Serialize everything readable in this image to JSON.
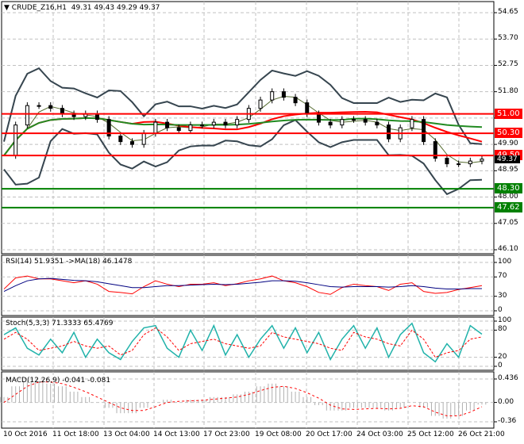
{
  "header": {
    "symbol": "CRUDE_Z16,H1",
    "ohlc": "49.31 49.43 49.29 49.37"
  },
  "indicators": {
    "rsi": "RSI(14) 51.9351  ->MA(18) 46.1478",
    "stoch": "Stoch(5,3,3) 71.3333 65.4769",
    "macd": "MACD(12,26,9) -0.041 -0.081"
  },
  "colors": {
    "resistance": "#ff0000",
    "support": "#008000",
    "bands": "#36454f",
    "ma_long": "#228b22",
    "ma_red": "#ff0000",
    "rsi": "#ff0000",
    "rsi_ma": "#000080",
    "stoch_k": "#20b2aa",
    "stoch_d": "#ff0000"
  },
  "chart_data": [
    {
      "type": "line",
      "title": "CRUDE_Z16,H1",
      "ylim": [
        46.1,
        54.65
      ],
      "yticks": [
        "54.65",
        "53.70",
        "52.75",
        "51.80",
        "50.85",
        "49.90",
        "48.95",
        "48.00",
        "47.05",
        "46.10"
      ],
      "xticks": [
        "10 Oct 2016",
        "11 Oct 18:00",
        "13 Oct 04:00",
        "14 Oct 13:00",
        "17 Oct 23:00",
        "19 Oct 08:00",
        "20 Oct 17:00",
        "24 Oct 03:00",
        "25 Oct 12:00",
        "26 Oct 21:00"
      ],
      "current_price": "49.37",
      "levels": [
        {
          "value": 51.0,
          "label": "51.00",
          "kind": "resistance"
        },
        {
          "value": 50.3,
          "label": "50.30",
          "kind": "resistance"
        },
        {
          "value": 49.5,
          "label": "49.50",
          "kind": "resistance"
        },
        {
          "value": 48.3,
          "label": "48.30",
          "kind": "support"
        },
        {
          "value": 47.62,
          "label": "47.62",
          "kind": "support"
        }
      ],
      "close": [
        49.5,
        50.6,
        51.3,
        51.3,
        51.2,
        51.0,
        50.9,
        51.0,
        50.8,
        50.2,
        50.0,
        49.9,
        50.3,
        50.7,
        50.5,
        50.4,
        50.6,
        50.6,
        50.7,
        50.6,
        50.8,
        51.2,
        51.5,
        51.8,
        51.6,
        51.4,
        51.0,
        50.7,
        50.6,
        50.8,
        50.8,
        50.7,
        50.6,
        50.1,
        50.5,
        50.8,
        50.0,
        49.4,
        49.2,
        49.2,
        49.3,
        49.37
      ]
    },
    {
      "type": "line",
      "name": "RSI",
      "ylim": [
        0,
        100
      ],
      "yticks": [
        "100",
        "70",
        "30",
        "0"
      ],
      "values": [
        45,
        68,
        72,
        66,
        66,
        62,
        58,
        62,
        55,
        40,
        38,
        35,
        50,
        62,
        55,
        50,
        55,
        55,
        58,
        52,
        56,
        62,
        66,
        72,
        62,
        58,
        50,
        38,
        34,
        48,
        55,
        52,
        50,
        42,
        55,
        58,
        40,
        36,
        38,
        44,
        48,
        52
      ],
      "ma": [
        40,
        52,
        62,
        66,
        67,
        65,
        63,
        62,
        60,
        56,
        52,
        48,
        48,
        50,
        52,
        52,
        53,
        54,
        55,
        54,
        55,
        57,
        59,
        62,
        62,
        61,
        58,
        54,
        50,
        49,
        50,
        50,
        50,
        49,
        50,
        52,
        50,
        47,
        45,
        45,
        46,
        46
      ]
    },
    {
      "type": "line",
      "name": "Stoch",
      "ylim": [
        0,
        100
      ],
      "yticks": [
        "100",
        "80",
        "20",
        "0"
      ],
      "k": [
        70,
        85,
        40,
        25,
        60,
        30,
        75,
        20,
        60,
        30,
        15,
        55,
        85,
        90,
        40,
        20,
        80,
        35,
        90,
        25,
        70,
        20,
        60,
        90,
        40,
        85,
        30,
        75,
        15,
        60,
        90,
        40,
        85,
        20,
        70,
        95,
        30,
        10,
        50,
        20,
        90,
        71
      ],
      "d": [
        60,
        75,
        60,
        35,
        40,
        45,
        55,
        45,
        40,
        45,
        25,
        35,
        70,
        85,
        65,
        35,
        50,
        55,
        60,
        50,
        45,
        40,
        45,
        75,
        65,
        60,
        55,
        50,
        40,
        35,
        75,
        65,
        60,
        50,
        45,
        80,
        60,
        20,
        30,
        35,
        60,
        65
      ]
    },
    {
      "type": "bar",
      "name": "MACD",
      "ylim": [
        -0.36,
        0.436
      ],
      "yticks": [
        "0.436",
        "0.00",
        "-0.36"
      ],
      "hist": [
        0.1,
        0.3,
        0.4,
        0.4,
        0.35,
        0.3,
        0.2,
        0.1,
        0.0,
        -0.1,
        -0.2,
        -0.2,
        -0.1,
        0.0,
        0.05,
        0.0,
        0.05,
        0.05,
        0.1,
        0.1,
        0.15,
        0.2,
        0.3,
        0.35,
        0.3,
        0.2,
        0.1,
        -0.05,
        -0.15,
        -0.15,
        -0.1,
        -0.1,
        -0.1,
        -0.15,
        -0.1,
        0.0,
        -0.1,
        -0.25,
        -0.3,
        -0.25,
        -0.15,
        -0.04
      ],
      "signal": [
        0.0,
        0.15,
        0.3,
        0.38,
        0.38,
        0.35,
        0.28,
        0.2,
        0.1,
        0.0,
        -0.1,
        -0.15,
        -0.15,
        -0.08,
        0.0,
        0.02,
        0.03,
        0.04,
        0.06,
        0.08,
        0.1,
        0.15,
        0.22,
        0.28,
        0.3,
        0.26,
        0.18,
        0.08,
        -0.05,
        -0.12,
        -0.13,
        -0.12,
        -0.11,
        -0.12,
        -0.11,
        -0.06,
        -0.08,
        -0.18,
        -0.25,
        -0.25,
        -0.18,
        -0.08
      ]
    }
  ]
}
